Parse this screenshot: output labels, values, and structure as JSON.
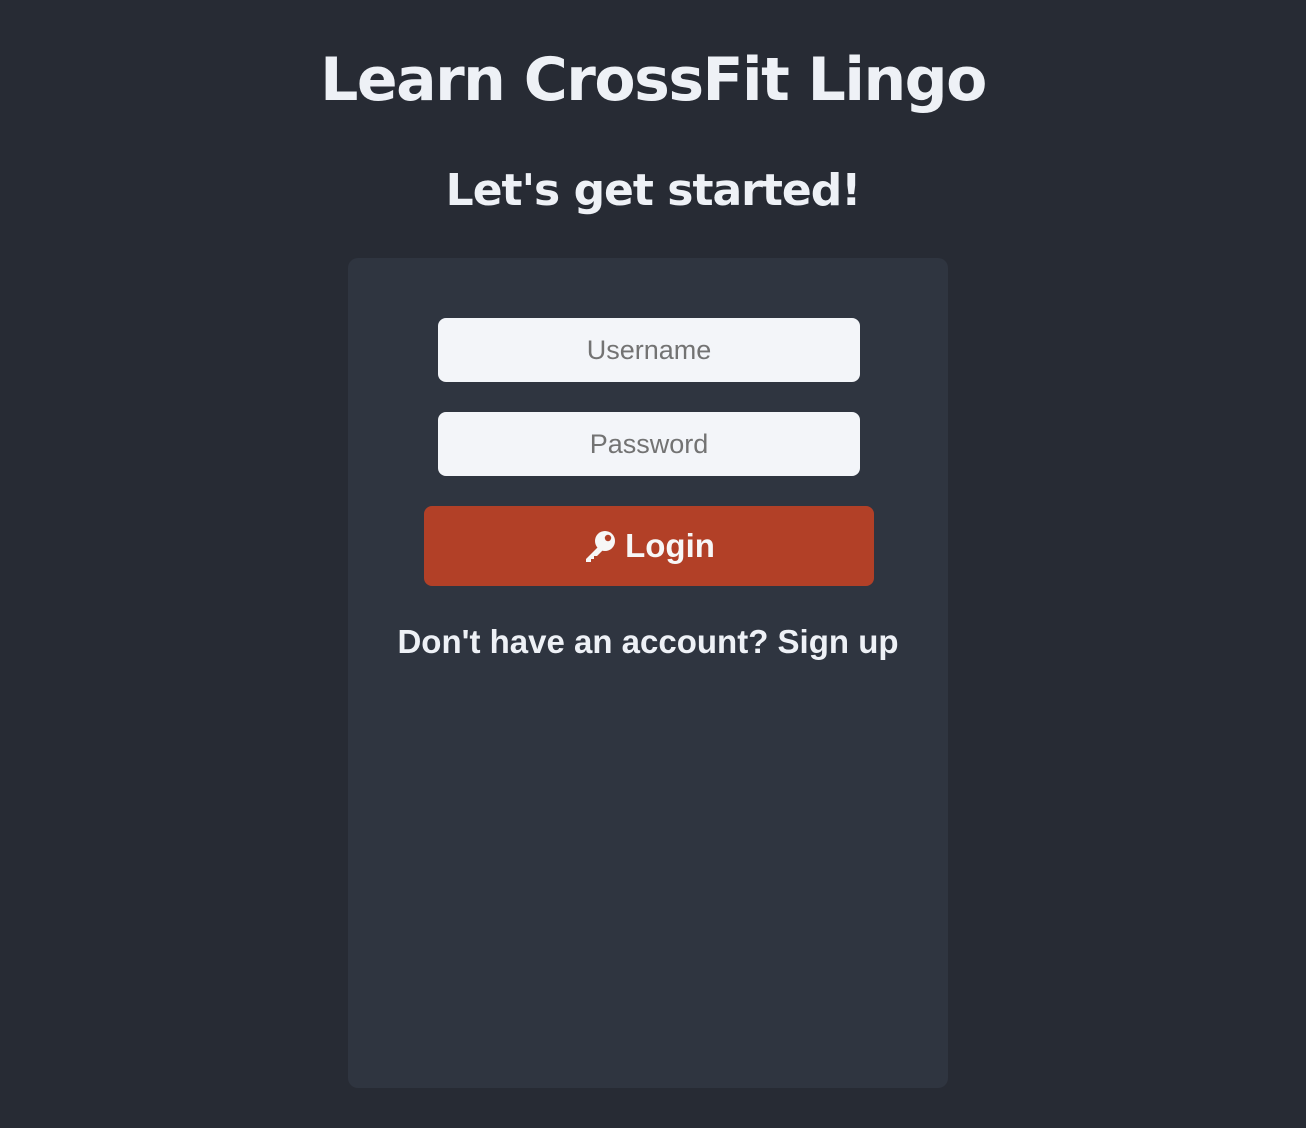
{
  "header": {
    "title": "Learn CrossFit Lingo",
    "subtitle": "Let's get started!"
  },
  "login_form": {
    "username_placeholder": "Username",
    "username_value": "",
    "password_placeholder": "Password",
    "password_value": "",
    "login_button_label": "Login",
    "login_button_icon": "key-icon",
    "signup_prompt": "Don't have an account?",
    "signup_link_label": "Sign up"
  },
  "colors": {
    "background": "#272b34",
    "card": "#2f3540",
    "input_background": "#f3f5f9",
    "accent": "#b24027",
    "text": "#eef1f6"
  }
}
